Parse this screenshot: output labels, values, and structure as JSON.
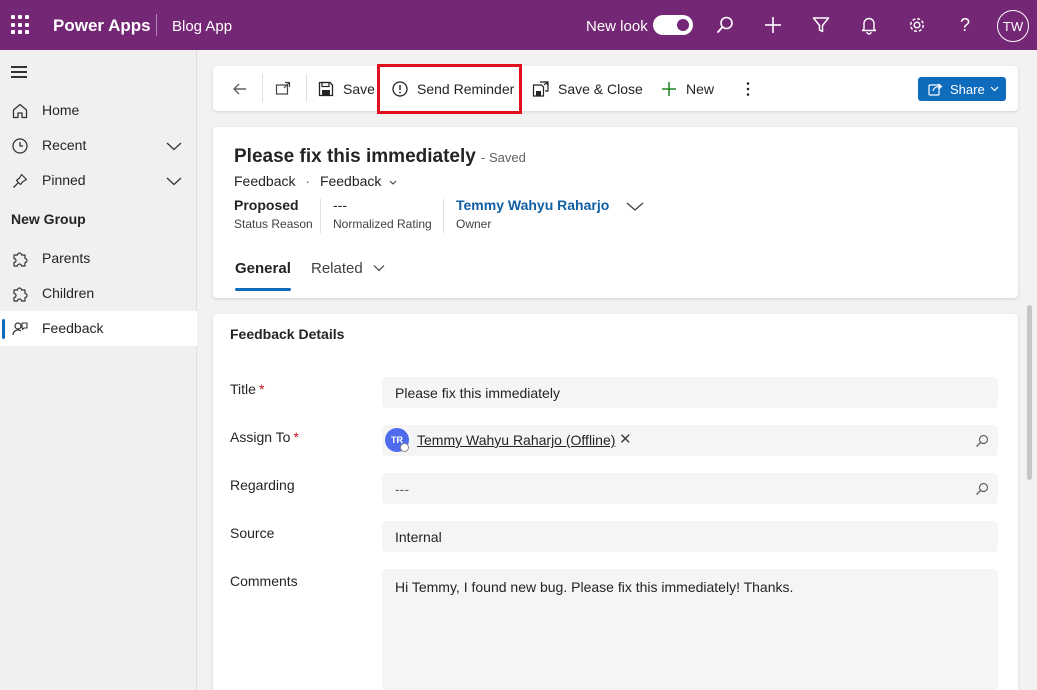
{
  "topbar": {
    "app_name": "Power Apps",
    "app_title": "Blog App",
    "new_look_label": "New look",
    "new_look_enabled": true,
    "avatar_initials": "TW",
    "icons": [
      "waffle-icon",
      "search-icon",
      "add-icon",
      "filter-icon",
      "bell-icon",
      "gear-icon",
      "help-icon"
    ]
  },
  "sidebar": {
    "items": [
      {
        "label": "Home",
        "icon": "home-icon"
      },
      {
        "label": "Recent",
        "icon": "clock-icon",
        "expandable": true
      },
      {
        "label": "Pinned",
        "icon": "pin-icon",
        "expandable": true
      }
    ],
    "group_title": "New Group",
    "group_items": [
      {
        "label": "Parents",
        "icon": "puzzle-icon"
      },
      {
        "label": "Children",
        "icon": "puzzle-icon"
      },
      {
        "label": "Feedback",
        "icon": "feedback-icon",
        "selected": true
      }
    ]
  },
  "commandbar": {
    "save_label": "Save",
    "send_reminder_label": "Send Reminder",
    "save_close_label": "Save & Close",
    "new_label": "New",
    "share_label": "Share",
    "highlighted": "send-reminder-button"
  },
  "record": {
    "title": "Please fix this immediately",
    "saved_status": "- Saved",
    "entity": "Feedback",
    "form_name": "Feedback",
    "header_fields": [
      {
        "value": "Proposed",
        "label": "Status Reason"
      },
      {
        "value": "---",
        "label": "Normalized Rating"
      },
      {
        "value": "Temmy Wahyu Raharjo",
        "label": "Owner"
      }
    ],
    "tabs": {
      "general": "General",
      "related": "Related"
    }
  },
  "details": {
    "section_title": "Feedback Details",
    "title_label": "Title",
    "title_value": "Please fix this immediately",
    "assign_label": "Assign To",
    "assign_initials": "TR",
    "assign_value": "Temmy Wahyu Raharjo (Offline)",
    "regarding_label": "Regarding",
    "regarding_value": "---",
    "source_label": "Source",
    "source_value": "Internal",
    "comments_label": "Comments",
    "comments_value": "Hi Temmy, I found new bug. Please fix this immediately! Thanks.",
    "required_marker": "*"
  },
  "colors": {
    "topbar": "#742774",
    "accent": "#0f6cbd",
    "highlight": "#e0101e",
    "required": "#c50f1f"
  }
}
